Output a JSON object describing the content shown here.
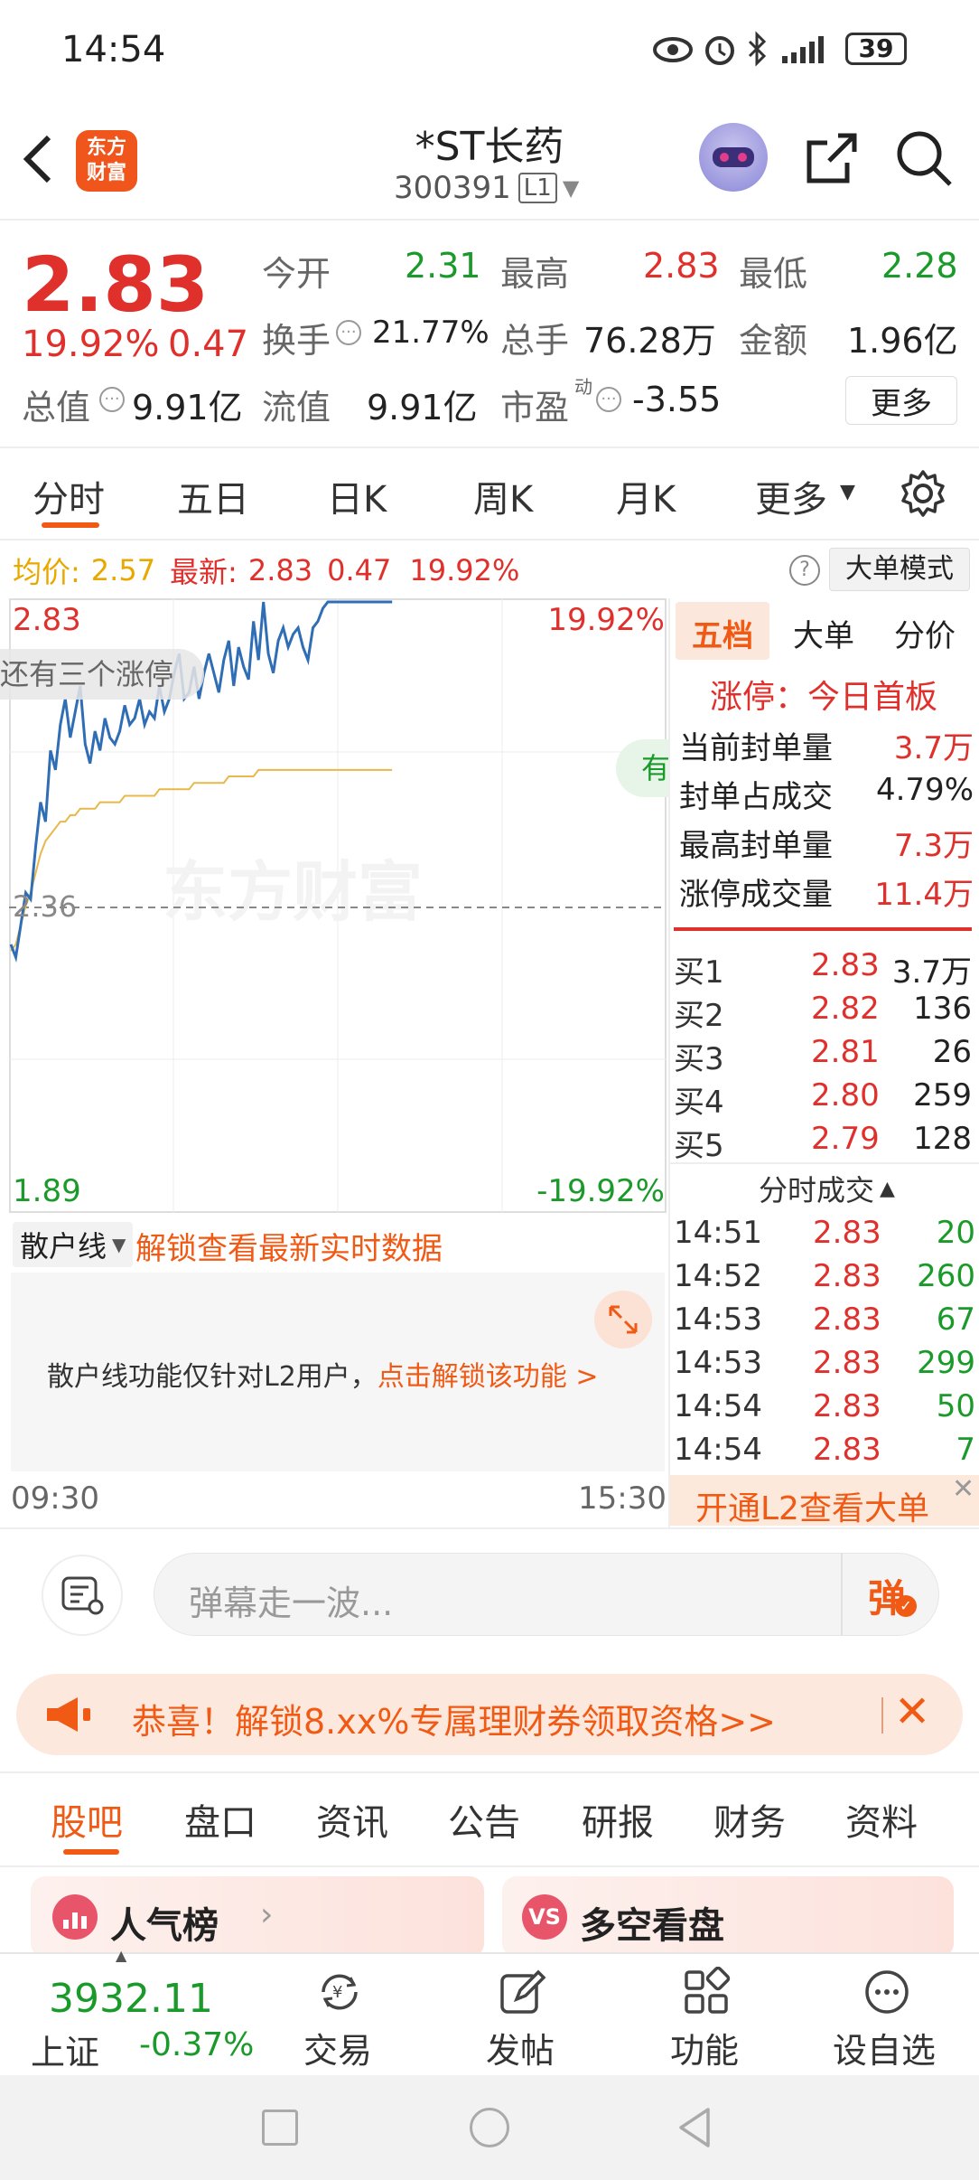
{
  "status_bar": {
    "time": "14:54",
    "battery": "39"
  },
  "header": {
    "title": "*ST长药",
    "code": "300391",
    "level": "L1",
    "logo_text": "东方\n财富"
  },
  "quote": {
    "price": "2.83",
    "change_pct": "19.92%",
    "change": "0.47",
    "open_label": "今开",
    "open": "2.31",
    "high_label": "最高",
    "high": "2.83",
    "low_label": "最低",
    "low": "2.28",
    "turnover_label": "换手",
    "turnover": "21.77%",
    "volume_label": "总手",
    "volume": "76.28万",
    "amount_label": "金额",
    "amount": "1.96亿",
    "mktcap_label": "总值",
    "mktcap": "9.91亿",
    "float_label": "流值",
    "float": "9.91亿",
    "pe_label": "市盈",
    "pe_sup": "动",
    "pe": "-3.55",
    "more": "更多"
  },
  "tabs": [
    "分时",
    "五日",
    "日K",
    "周K",
    "月K",
    "更多"
  ],
  "chart_info": {
    "avg_label": "均价:",
    "avg": "2.57",
    "latest_label": "最新:",
    "latest": "2.83",
    "change": "0.47",
    "pct": "19.92%",
    "big_order_mode": "大单模式",
    "help": "?"
  },
  "chart_data": {
    "type": "line",
    "x_start": "09:30",
    "x_end": "15:30",
    "y_top": "2.83",
    "y_mid": "2.36",
    "y_bottom": "1.89",
    "pct_top": "19.92%",
    "pct_bottom": "-19.92%",
    "ylim": [
      1.89,
      2.83
    ],
    "series": [
      {
        "color": "#2f6db5",
        "values": [
          2.3,
          2.28,
          2.33,
          2.38,
          2.37,
          2.45,
          2.52,
          2.49,
          2.6,
          2.57,
          2.64,
          2.68,
          2.62,
          2.66,
          2.7,
          2.61,
          2.58,
          2.63,
          2.6,
          2.65,
          2.62,
          2.61,
          2.63,
          2.67,
          2.64,
          2.65,
          2.68,
          2.64,
          2.66,
          2.65,
          2.7,
          2.66,
          2.68,
          2.72,
          2.75,
          2.68,
          2.69,
          2.73,
          2.68,
          2.72,
          2.75,
          2.72,
          2.69,
          2.74,
          2.77,
          2.7,
          2.76,
          2.73,
          2.71,
          2.8,
          2.74,
          2.83,
          2.75,
          2.72,
          2.77,
          2.79,
          2.76,
          2.78,
          2.79,
          2.76,
          2.74,
          2.79,
          2.8,
          2.82,
          2.83,
          2.83,
          2.83,
          2.83,
          2.83,
          2.83,
          2.83,
          2.83,
          2.83,
          2.83,
          2.83,
          2.83,
          2.83,
          2.83
        ]
      },
      {
        "color": "#e8b84a",
        "values": [
          2.29,
          2.3,
          2.33,
          2.36,
          2.38,
          2.41,
          2.44,
          2.46,
          2.47,
          2.48,
          2.49,
          2.49,
          2.5,
          2.5,
          2.51,
          2.51,
          2.51,
          2.51,
          2.52,
          2.52,
          2.52,
          2.52,
          2.52,
          2.53,
          2.53,
          2.53,
          2.53,
          2.53,
          2.53,
          2.53,
          2.54,
          2.54,
          2.54,
          2.54,
          2.54,
          2.54,
          2.54,
          2.55,
          2.55,
          2.55,
          2.55,
          2.55,
          2.55,
          2.55,
          2.56,
          2.56,
          2.56,
          2.56,
          2.56,
          2.56,
          2.57,
          2.57,
          2.57,
          2.57,
          2.57,
          2.57,
          2.57,
          2.57,
          2.57,
          2.57,
          2.57,
          2.57,
          2.57,
          2.57,
          2.57,
          2.57,
          2.57,
          2.57,
          2.57,
          2.57,
          2.57,
          2.57,
          2.57,
          2.57,
          2.57,
          2.57,
          2.57,
          2.57
        ]
      }
    ]
  },
  "chart_overlay": {
    "badge": "还有三个涨停",
    "watermark": "东方财富",
    "side_badge": "有"
  },
  "sanhu": {
    "dropdown": "散户线",
    "unlock": "解锁查看最新实时数据",
    "note": "散户线功能仅针对L2用户，",
    "note_link": "点击解锁该功能 >"
  },
  "side": {
    "tabs": [
      "五档",
      "大单",
      "分价"
    ],
    "limit_title": "涨停：今日首板",
    "stats": [
      {
        "label": "当前封单量",
        "value": "3.7万"
      },
      {
        "label": "封单占成交",
        "value": "4.79%"
      },
      {
        "label": "最高封单量",
        "value": "7.3万"
      },
      {
        "label": "涨停成交量",
        "value": "11.4万"
      }
    ],
    "bids": [
      {
        "label": "买1",
        "price": "2.83",
        "vol": "3.7万"
      },
      {
        "label": "买2",
        "price": "2.82",
        "vol": "136"
      },
      {
        "label": "买3",
        "price": "2.81",
        "vol": "26"
      },
      {
        "label": "买4",
        "price": "2.80",
        "vol": "259"
      },
      {
        "label": "买5",
        "price": "2.79",
        "vol": "128"
      }
    ],
    "ticks_title": "分时成交",
    "ticks": [
      {
        "time": "14:51",
        "price": "2.83",
        "vol": "20"
      },
      {
        "time": "14:52",
        "price": "2.83",
        "vol": "260"
      },
      {
        "time": "14:53",
        "price": "2.83",
        "vol": "67"
      },
      {
        "time": "14:53",
        "price": "2.83",
        "vol": "299"
      },
      {
        "time": "14:54",
        "price": "2.83",
        "vol": "50"
      },
      {
        "time": "14:54",
        "price": "2.83",
        "vol": "7"
      }
    ],
    "l2_banner": "开通L2查看大单"
  },
  "danmaku": {
    "placeholder": "弹幕走一波...",
    "send": "弹"
  },
  "promo": {
    "text": "恭喜！解锁8.xx%专属理财券领取资格>>"
  },
  "section_tabs": [
    "股吧",
    "盘口",
    "资讯",
    "公告",
    "研报",
    "财务",
    "资料"
  ],
  "cards": [
    {
      "title": "人气榜"
    },
    {
      "title": "多空看盘"
    }
  ],
  "bottom_nav": {
    "index_value": "3932.11",
    "index_name": "上证",
    "index_change": "-0.37%",
    "items": [
      {
        "label": "交易"
      },
      {
        "label": "发帖"
      },
      {
        "label": "功能"
      },
      {
        "label": "设自选"
      }
    ]
  }
}
